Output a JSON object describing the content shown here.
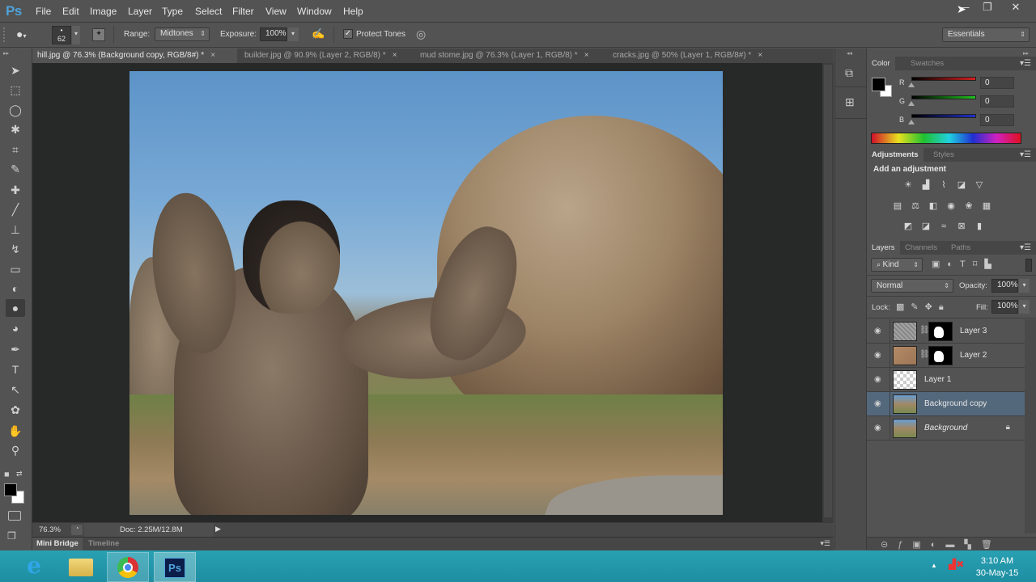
{
  "app": {
    "logo": "Ps"
  },
  "menu": [
    "File",
    "Edit",
    "Image",
    "Layer",
    "Type",
    "Select",
    "Filter",
    "View",
    "Window",
    "Help"
  ],
  "window_controls": {
    "minimize": "—",
    "restore": "❐",
    "close": "✕"
  },
  "options_bar": {
    "brush_size": "62",
    "range_label": "Range:",
    "range_value": "Midtones",
    "exposure_label": "Exposure:",
    "exposure_value": "100%",
    "protect_tones_label": "Protect Tones",
    "protect_tones_checked": true,
    "workspace": "Essentials"
  },
  "tabs": [
    {
      "label": "hill.jpg @ 76.3% (Background copy, RGB/8#) *",
      "active": true
    },
    {
      "label": "builder.jpg @ 90.9% (Layer 2, RGB/8) *",
      "active": false
    },
    {
      "label": "mud stome.jpg @ 76.3% (Layer 1, RGB/8) *",
      "active": false
    },
    {
      "label": "cracks.jpg @ 50% (Layer 1, RGB/8#) *",
      "active": false
    }
  ],
  "tab_close": "×",
  "tools": [
    "move",
    "marquee",
    "lasso",
    "magic-wand",
    "crop",
    "eyedropper",
    "healing-brush",
    "brush",
    "clone-stamp",
    "history-brush",
    "eraser",
    "paint-bucket",
    "burn",
    "dodge",
    "pen",
    "type",
    "path-selection",
    "custom-shape",
    "hand",
    "zoom"
  ],
  "tool_glyphs": [
    "➤",
    "⬚",
    "◯",
    "✱",
    "⌗",
    "✎",
    "✚",
    "╱",
    "⊥",
    "↯",
    "▭",
    "◐",
    "●",
    "◕",
    "✒",
    "T",
    "↖",
    "✿",
    "✋",
    "⚲"
  ],
  "status": {
    "zoom": "76.3%",
    "doc": "Doc: 2.25M/12.8M"
  },
  "bottom_panels": [
    {
      "label": "Mini Bridge",
      "active": true
    },
    {
      "label": "Timeline",
      "active": false
    }
  ],
  "color_panel": {
    "tabs": [
      {
        "label": "Color",
        "active": true
      },
      {
        "label": "Swatches",
        "active": false
      }
    ],
    "channels": [
      {
        "label": "R",
        "value": "0",
        "color": "#d42020"
      },
      {
        "label": "G",
        "value": "0",
        "color": "#20c020"
      },
      {
        "label": "B",
        "value": "0",
        "color": "#2030c8"
      }
    ]
  },
  "adjustments_panel": {
    "tabs": [
      {
        "label": "Adjustments",
        "active": true
      },
      {
        "label": "Styles",
        "active": false
      }
    ],
    "heading": "Add an adjustment",
    "rows": [
      [
        "☀",
        "▟",
        "⌇",
        "◪",
        "▽"
      ],
      [
        "▤",
        "⚖",
        "◧",
        "◉",
        "❀",
        "▦"
      ],
      [
        "◩",
        "◪",
        "≈",
        "⊠",
        "▮"
      ]
    ]
  },
  "layers_panel": {
    "tabs": [
      {
        "label": "Layers",
        "active": true
      },
      {
        "label": "Channels",
        "active": false
      },
      {
        "label": "Paths",
        "active": false
      }
    ],
    "filter_kind": "Kind",
    "blend_mode": "Normal",
    "opacity_label": "Opacity:",
    "opacity": "100%",
    "lock_label": "Lock:",
    "fill_label": "Fill:",
    "fill": "100%",
    "layers": [
      {
        "name": "Layer 3",
        "visible": true,
        "selected": false,
        "has_mask": true,
        "locked": false
      },
      {
        "name": "Layer 2",
        "visible": true,
        "selected": false,
        "has_mask": true,
        "locked": false
      },
      {
        "name": "Layer 1",
        "visible": true,
        "selected": false,
        "has_mask": false,
        "locked": false
      },
      {
        "name": "Background copy",
        "visible": true,
        "selected": true,
        "has_mask": false,
        "locked": false
      },
      {
        "name": "Background",
        "visible": true,
        "selected": false,
        "has_mask": false,
        "locked": true
      }
    ],
    "footer_icons": [
      "link",
      "fx",
      "mask",
      "adjustment",
      "group",
      "new-layer",
      "delete"
    ]
  },
  "taskbar": {
    "apps": [
      "internet-explorer",
      "file-explorer",
      "chrome",
      "photoshop"
    ],
    "time": "3:10 AM",
    "date": "30-May-15"
  }
}
